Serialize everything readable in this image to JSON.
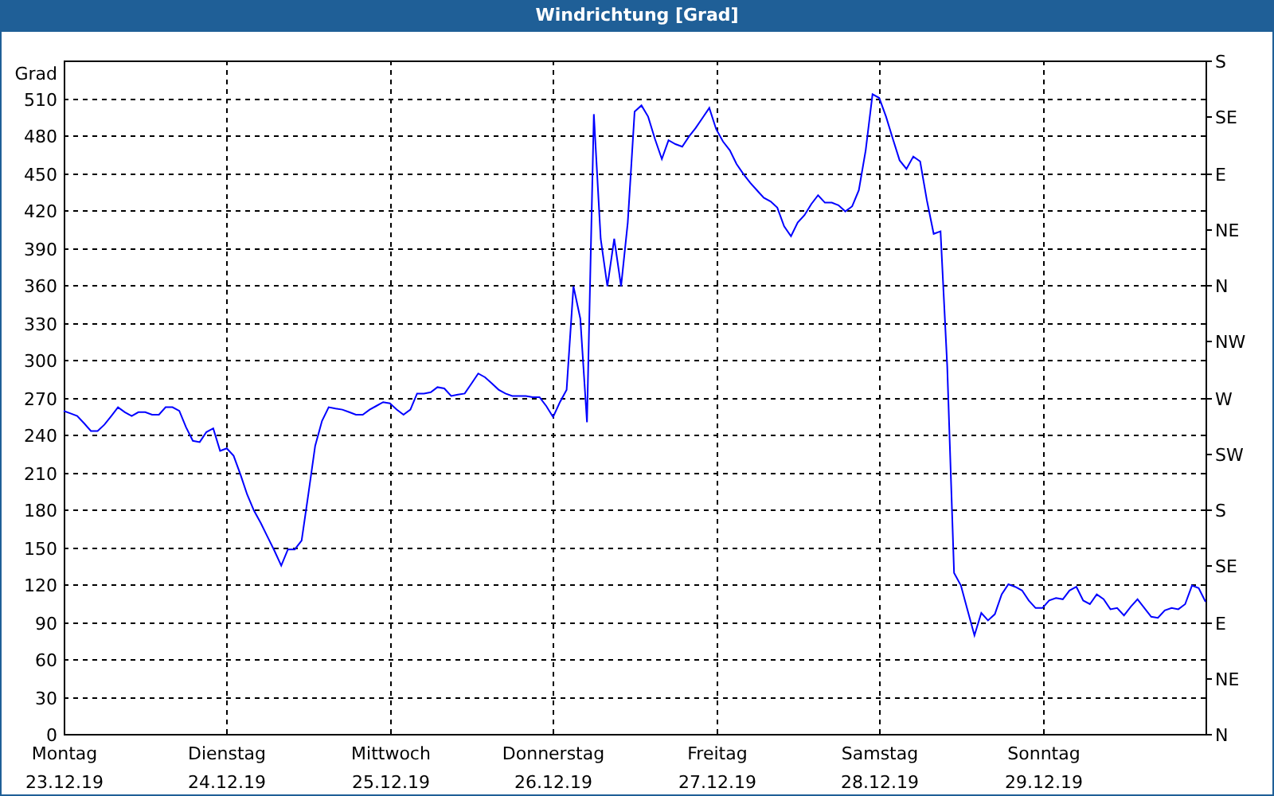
{
  "window": {
    "title": "Windrichtung [Grad]"
  },
  "chart": {
    "chart_data": {
      "type": "line",
      "grid": true,
      "ylabel": "Grad",
      "ylim": [
        0,
        540
      ],
      "categories": [
        "Montag 23.12.19",
        null,
        null,
        null,
        null,
        null,
        null,
        null,
        null,
        null,
        null,
        null,
        null,
        null,
        null,
        null,
        null,
        null,
        null,
        null,
        null,
        null,
        null,
        null,
        "Dienstag 24.12.19",
        null,
        null,
        null,
        null,
        null,
        null,
        null,
        null,
        null,
        null,
        null,
        null,
        null,
        null,
        null,
        null,
        null,
        null,
        null,
        null,
        null,
        null,
        null,
        "Mittwoch 25.12.19",
        null,
        null,
        null,
        null,
        null,
        null,
        null,
        null,
        null,
        null,
        null,
        null,
        null,
        null,
        null,
        null,
        null,
        null,
        null,
        null,
        null,
        null,
        null,
        "Donnerstag 26.12.19",
        null,
        null,
        null,
        null,
        null,
        null,
        null,
        null,
        null,
        null,
        null,
        null,
        null,
        null,
        null,
        null,
        null,
        null,
        null,
        null,
        null,
        null,
        null,
        "Freitag 27.12.19",
        null,
        null,
        null,
        null,
        null,
        null,
        null,
        null,
        null,
        null,
        null,
        null,
        null,
        null,
        null,
        null,
        null,
        null,
        null,
        null,
        null,
        null,
        null,
        "Samstag 28.12.19",
        null,
        null,
        null,
        null,
        null,
        null,
        null,
        null,
        null,
        null,
        null,
        null,
        null,
        null,
        null,
        null,
        null,
        null,
        null,
        null,
        null,
        null,
        null,
        "Sonntag 29.12.19",
        null,
        null,
        null,
        null,
        null,
        null,
        null,
        null,
        null,
        null,
        null,
        null,
        null,
        null,
        null,
        null,
        null,
        null,
        null,
        null,
        null,
        null,
        null,
        null
      ],
      "yticks": [
        0,
        30,
        60,
        90,
        120,
        150,
        180,
        210,
        240,
        270,
        300,
        330,
        360,
        390,
        420,
        450,
        480,
        510
      ],
      "series": [
        {
          "color": "#0000ff",
          "values": [
            259,
            257,
            255,
            249,
            243,
            243,
            248,
            255,
            262,
            258,
            255,
            258,
            258,
            256,
            256,
            262,
            262,
            259,
            246,
            235,
            234,
            242,
            245,
            227,
            229,
            223,
            208,
            192,
            179,
            169,
            158,
            147,
            135,
            148,
            148,
            155,
            192,
            231,
            251,
            262,
            261,
            260,
            258,
            256,
            256,
            260,
            263,
            266,
            265,
            260,
            256,
            260,
            273,
            273,
            274,
            278,
            277,
            271,
            272,
            273,
            281,
            289,
            286,
            281,
            276,
            273,
            271,
            271,
            271,
            270,
            270,
            263,
            254,
            266,
            276,
            359,
            333,
            250,
            497,
            397,
            359,
            397,
            359,
            410,
            499,
            504,
            495,
            477,
            461,
            476,
            473,
            471,
            479,
            486,
            494,
            502,
            485,
            475,
            468,
            457,
            449,
            442,
            436,
            430,
            427,
            422,
            407,
            399,
            410,
            416,
            425,
            432,
            426,
            426,
            424,
            419,
            423,
            436,
            468,
            513,
            510,
            495,
            477,
            460,
            453,
            463,
            459,
            428,
            401,
            403,
            295,
            129,
            119,
            99,
            79,
            97,
            91,
            96,
            112,
            120,
            118,
            115,
            107,
            101,
            101,
            107,
            109,
            108,
            115,
            118,
            107,
            104,
            112,
            108,
            100,
            101,
            95,
            102,
            108,
            101,
            94,
            93,
            99,
            101,
            100,
            104,
            119,
            117,
            106
          ]
        }
      ]
    },
    "right_axis": {
      "ticks": [
        "S",
        "SE",
        "E",
        "NE",
        "N",
        "NW",
        "W",
        "SW",
        "S",
        "SE",
        "E",
        "NE",
        "N"
      ]
    }
  }
}
